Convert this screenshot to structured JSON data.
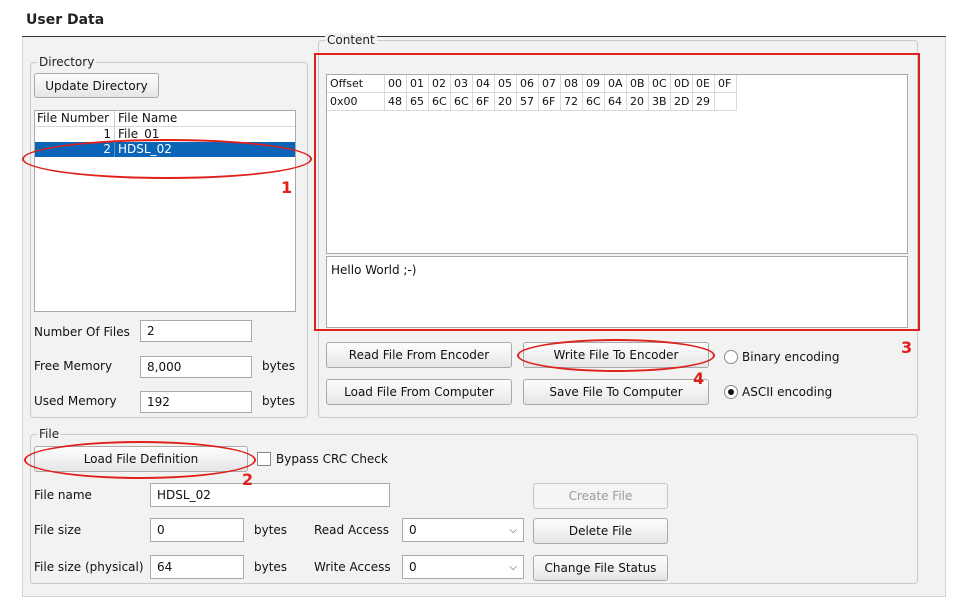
{
  "panel": {
    "title": "User Data"
  },
  "directory": {
    "legend": "Directory",
    "update_button": "Update Directory",
    "columns": [
      "File Number",
      "File Name"
    ],
    "rows": [
      {
        "number": "1",
        "name": "File_01",
        "selected": false
      },
      {
        "number": "2",
        "name": "HDSL_02",
        "selected": true
      }
    ],
    "number_of_files_label": "Number Of Files",
    "number_of_files_value": "2",
    "free_memory_label": "Free Memory",
    "free_memory_value": "8,000",
    "free_memory_unit": "bytes",
    "used_memory_label": "Used Memory",
    "used_memory_value": "192",
    "used_memory_unit": "bytes"
  },
  "content": {
    "legend": "Content",
    "hex_headers": [
      "Offset",
      "00",
      "01",
      "02",
      "03",
      "04",
      "05",
      "06",
      "07",
      "08",
      "09",
      "0A",
      "0B",
      "0C",
      "0D",
      "0E",
      "0F"
    ],
    "hex_rows": [
      [
        "0x00",
        "48",
        "65",
        "6C",
        "6C",
        "6F",
        "20",
        "57",
        "6F",
        "72",
        "6C",
        "64",
        "20",
        "3B",
        "2D",
        "29",
        ""
      ]
    ],
    "text": "Hello World ;-)",
    "read_button": "Read File From Encoder",
    "write_button": "Write File To Encoder",
    "load_button": "Load File From Computer",
    "save_button": "Save File To Computer",
    "binary_label": "Binary encoding",
    "ascii_label": "ASCII encoding"
  },
  "file": {
    "legend": "File",
    "load_definition_button": "Load File Definition",
    "bypass_crc_label": "Bypass CRC Check",
    "name_label": "File name",
    "name_value": "HDSL_02",
    "size_label": "File size",
    "size_value": "0",
    "size_unit": "bytes",
    "physical_label": "File size (physical)",
    "physical_value": "64",
    "physical_unit": "bytes",
    "read_access_label": "Read Access",
    "read_access_value": "0",
    "write_access_label": "Write Access",
    "write_access_value": "0",
    "create_button": "Create File",
    "delete_button": "Delete File",
    "change_status_button": "Change File Status"
  },
  "annotations": {
    "n1": "1",
    "n2": "2",
    "n3": "3",
    "n4": "4",
    "color": "#e0201a"
  }
}
